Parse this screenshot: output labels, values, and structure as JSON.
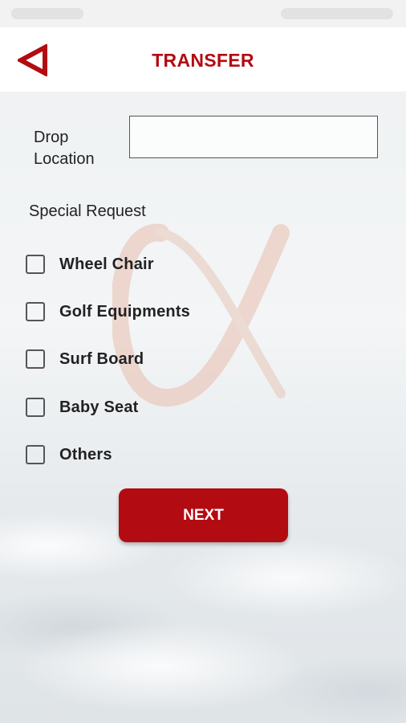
{
  "header": {
    "title": "TRANSFER",
    "back_icon": "back-triangle-icon"
  },
  "form": {
    "drop_location": {
      "label": "Drop Location",
      "value": "",
      "placeholder": ""
    },
    "special_request": {
      "heading": "Special Request",
      "options": [
        {
          "label": "Wheel Chair",
          "checked": false
        },
        {
          "label": "Golf Equipments",
          "checked": false
        },
        {
          "label": "Surf Board",
          "checked": false
        },
        {
          "label": "Baby Seat",
          "checked": false
        },
        {
          "label": "Others",
          "checked": false
        }
      ]
    }
  },
  "actions": {
    "next_label": "NEXT"
  },
  "colors": {
    "accent": "#b30b12",
    "header_bg": "#ffffff"
  }
}
